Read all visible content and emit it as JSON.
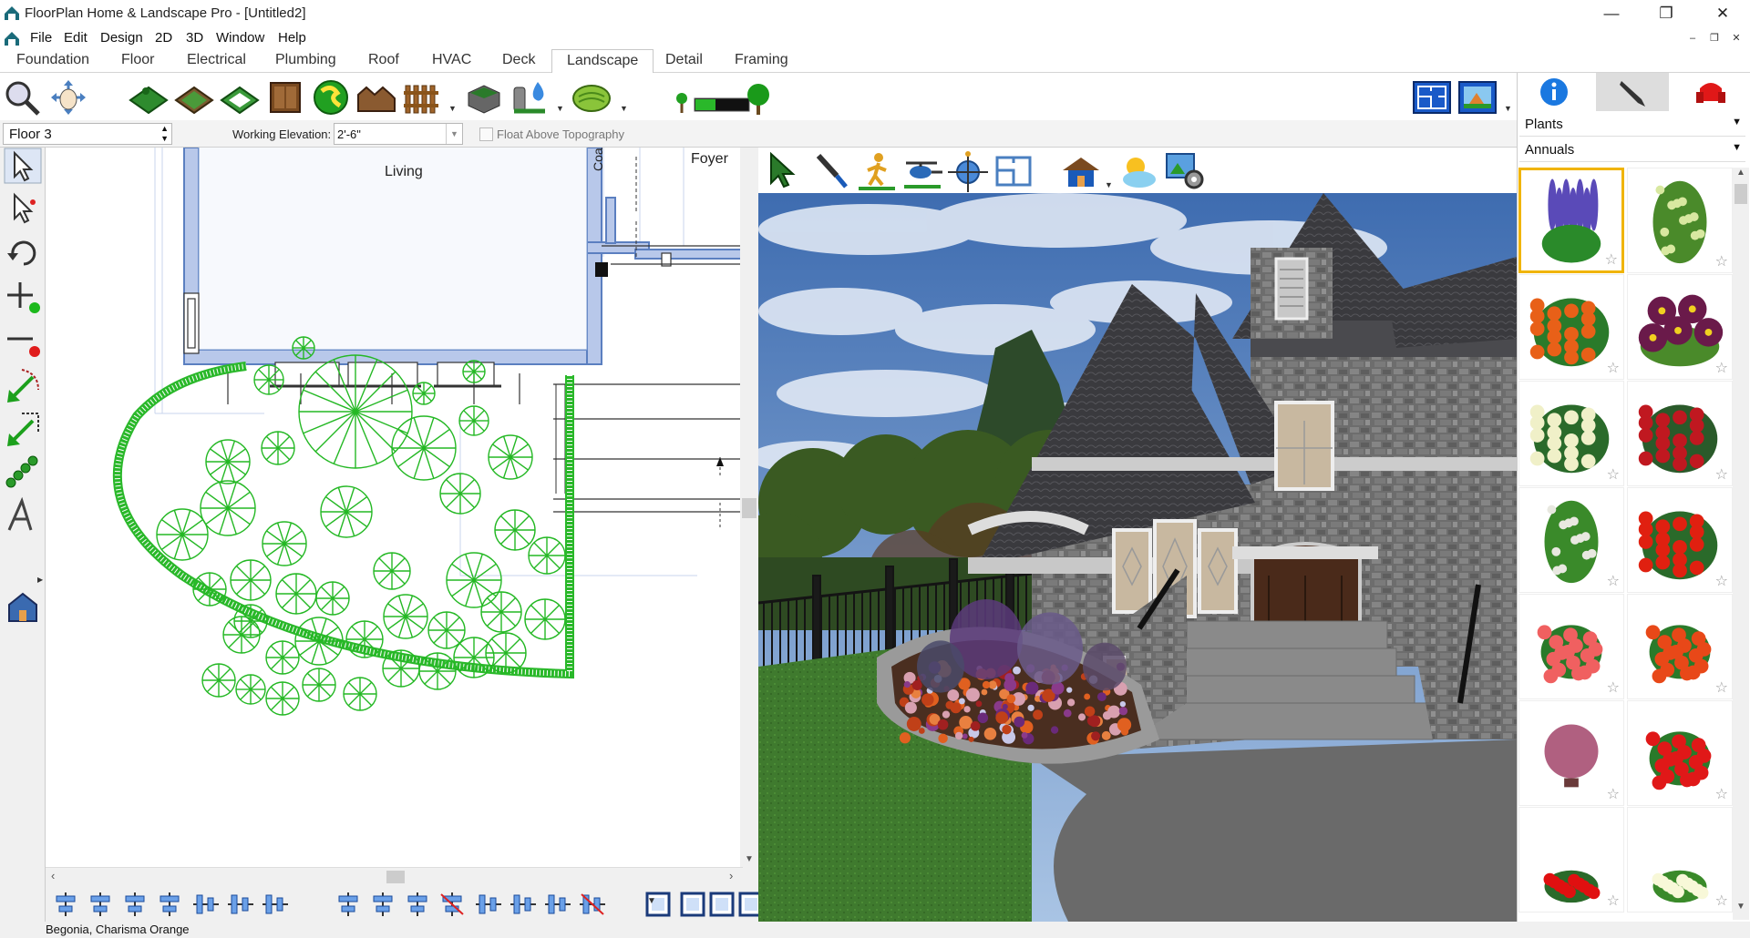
{
  "window": {
    "title": "FloorPlan Home & Landscape Pro - [Untitled2]",
    "minimize": "—",
    "restore": "❐",
    "close": "✕"
  },
  "menu": [
    "File",
    "Edit",
    "Design",
    "2D",
    "3D",
    "Window",
    "Help"
  ],
  "mdi_controls": [
    "–",
    "❐",
    "✕"
  ],
  "tabs": [
    "Foundation",
    "Floor",
    "Electrical",
    "Plumbing",
    "Roof",
    "HVAC",
    "Deck",
    "Landscape",
    "Detail",
    "Framing"
  ],
  "active_tab": "Landscape",
  "options": {
    "floor": "Floor 3",
    "working_elevation_label": "Working Elevation:",
    "working_elevation": "2'-6\"",
    "float_label": "Float Above Topography"
  },
  "plan": {
    "room_living": "Living",
    "room_foyer": "Foyer",
    "room_coat": "Coa"
  },
  "right_panel": {
    "category": "Plants",
    "subcategory": "Annuals",
    "star": "☆"
  },
  "status": "Begonia, Charisma Orange",
  "colors": {
    "accent": "#f0b400",
    "plan_wall": "#5b7fc0",
    "plants_2d": "#22bb22"
  }
}
